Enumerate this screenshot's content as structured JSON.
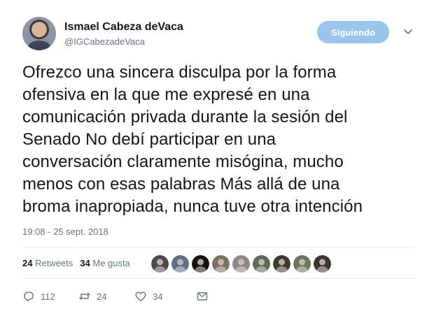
{
  "author": {
    "name": "Ismael Cabeza deVaca",
    "handle": "@IGCabezadeVaca"
  },
  "follow_button": {
    "label": "Siguiendo",
    "color": "#9ac5ea"
  },
  "tweet": {
    "text": "Ofrezco una sincera disculpa por la forma\nofensiva en la que me expresé en una\ncomunicación privada durante la sesión del\nSenado  No debí participar en una\nconversación claramente misógina, mucho\nmenos con esas palabras Más allá de una\nbroma inapropiada, nunca tuve otra intención",
    "timestamp": "19:08 - 25 sept. 2018"
  },
  "stats": {
    "retweets_count": "24",
    "retweets_label": "Retweets",
    "likes_count": "34",
    "likes_label": "Me gusta"
  },
  "likers": [
    {
      "icon": "liker-avatar-1",
      "color": "#4a4a4a"
    },
    {
      "icon": "liker-avatar-2",
      "color": "#5c6f86"
    },
    {
      "icon": "liker-avatar-3-va-logo",
      "color": "#111111"
    },
    {
      "icon": "liker-avatar-4",
      "color": "#7b7167"
    },
    {
      "icon": "liker-avatar-5",
      "color": "#8a8a8a"
    },
    {
      "icon": "liker-avatar-6",
      "color": "#5d6b5a"
    },
    {
      "icon": "liker-avatar-7",
      "color": "#3c3a36"
    },
    {
      "icon": "liker-avatar-8",
      "color": "#6a7a60"
    },
    {
      "icon": "liker-avatar-9",
      "color": "#3a3432"
    }
  ],
  "actions": {
    "replies": "112",
    "retweets": "24",
    "likes": "34"
  },
  "colors": {
    "text": "#14171a",
    "secondary": "#657786",
    "divider": "#e6ecf0"
  }
}
